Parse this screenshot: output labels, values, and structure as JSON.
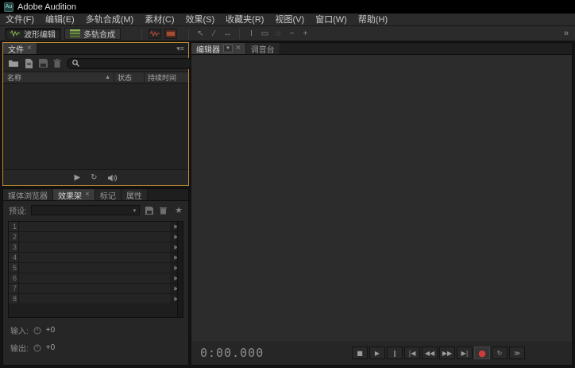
{
  "window": {
    "title": "Adobe Audition",
    "app_icon_text": "Au"
  },
  "menu_bar": {
    "items": [
      "文件(F)",
      "编辑(E)",
      "多轨合成(M)",
      "素材(C)",
      "效果(S)",
      "收藏夹(R)",
      "视图(V)",
      "窗口(W)",
      "帮助(H)"
    ]
  },
  "toolbar": {
    "workspace_buttons": [
      {
        "name": "waveform-editor",
        "label": "波形编辑"
      },
      {
        "name": "multitrack",
        "label": "多轨合成"
      }
    ],
    "display_toggles": [
      {
        "name": "show-waveform-icon"
      },
      {
        "name": "show-spectral-icon"
      }
    ],
    "tools": [
      {
        "name": "move-tool",
        "glyph": "↖"
      },
      {
        "name": "razor-tool",
        "glyph": "⁄"
      },
      {
        "name": "slip-tool",
        "glyph": "↔"
      },
      {
        "name": "time-selection-tool",
        "glyph": "I"
      },
      {
        "name": "marquee-selection-tool",
        "glyph": "▭"
      },
      {
        "name": "lasso-selection-tool",
        "glyph": "◌"
      },
      {
        "name": "paintbrush-tool",
        "glyph": "~"
      },
      {
        "name": "spot-healing-tool",
        "glyph": "+"
      }
    ],
    "overflow_glyph": "»"
  },
  "files_panel": {
    "tab_label": "文件",
    "close_glyph": "×",
    "panel_menu_glyph": "▾≡",
    "search_value": "",
    "columns": [
      "名称",
      "状态",
      "持续时间"
    ],
    "sort_glyph": "▲",
    "footer": {
      "play_glyph": "▶",
      "loop_glyph": "↻"
    }
  },
  "rack_panel": {
    "tabs": [
      "媒体浏览器",
      "效果架",
      "标记",
      "属性"
    ],
    "close_glyph": "×",
    "preset_label": "预设:",
    "preset_value": "",
    "dropdown_caret": "▾",
    "star_glyph": "★",
    "slots": [
      "1",
      "2",
      "3",
      "4",
      "5",
      "6",
      "7",
      "8"
    ],
    "slot_arrow_glyph": "▶",
    "input_label": "输入:",
    "output_label": "输出:",
    "input_gain": "+0",
    "output_gain": "+0"
  },
  "editor_panel": {
    "tabs": [
      "编辑器",
      "调音台"
    ],
    "dropdown_glyph": "▼",
    "close_glyph": "×",
    "time_display": "0:00.000"
  },
  "transport": {
    "buttons": [
      {
        "name": "stop",
        "glyph": "■"
      },
      {
        "name": "play",
        "glyph": "▶"
      },
      {
        "name": "pause",
        "glyph": "‖"
      },
      {
        "name": "move-to-previous",
        "glyph": "|◀"
      },
      {
        "name": "rewind",
        "glyph": "◀◀"
      },
      {
        "name": "fast-forward",
        "glyph": "▶▶"
      },
      {
        "name": "move-to-next",
        "glyph": "▶|"
      },
      {
        "name": "record",
        "glyph": "●"
      },
      {
        "name": "loop-playback",
        "glyph": "↻"
      },
      {
        "name": "skip-selection",
        "glyph": "≫"
      }
    ]
  },
  "colors": {
    "focus_border": "#bf8a2e",
    "record_red": "#d03c3c",
    "workspace_icon_green": "#86b34f",
    "spectral_icon_red": "#a34f2f"
  }
}
